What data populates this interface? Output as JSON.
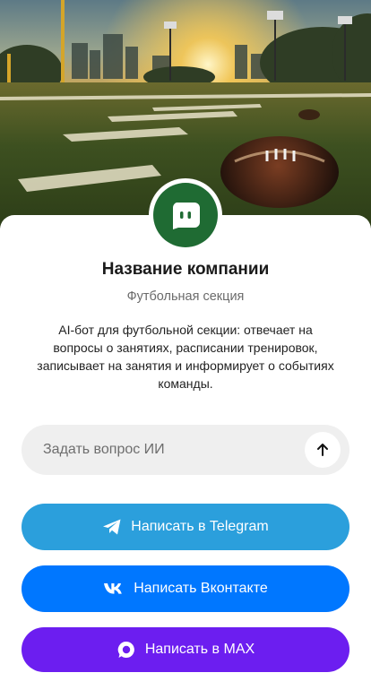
{
  "colors": {
    "avatar_bg": "#1f6b33",
    "telegram": "#2b9fdc",
    "vk": "#0077ff",
    "max": "#6c1ef0",
    "input_bg": "#efefef"
  },
  "hero": {
    "image": "football-field-sunset-photo"
  },
  "company": {
    "avatar_icon": "bot-face-icon",
    "name": "Название компании",
    "category": "Футбольная секция",
    "description": "AI-бот для футбольной секции: отвечает на вопросы о занятиях, расписании тренировок, записывает на занятия и информирует о событиях команды."
  },
  "ask": {
    "placeholder": "Задать вопрос ИИ",
    "value": "",
    "send_icon": "arrow-up-icon"
  },
  "buttons": {
    "telegram": {
      "label": "Написать в Telegram",
      "icon": "telegram-icon"
    },
    "vk": {
      "label": "Написать Вконтакте",
      "icon": "vk-icon"
    },
    "max": {
      "label": "Написать в MAX",
      "icon": "max-icon"
    }
  }
}
